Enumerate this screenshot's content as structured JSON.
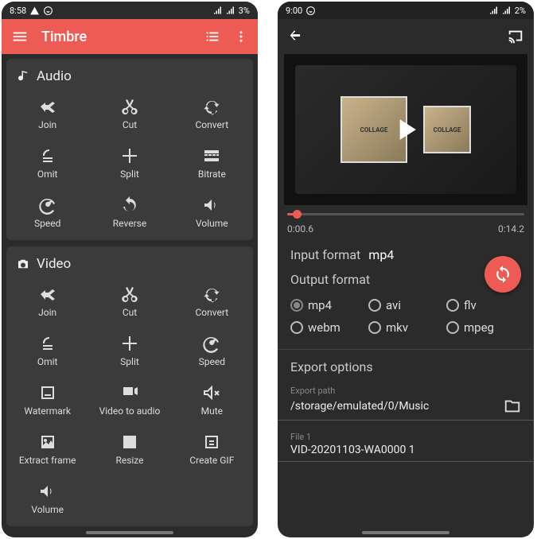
{
  "phone1": {
    "status": {
      "time": "8:58",
      "battery": "3%"
    },
    "toolbar": {
      "title": "Timbre"
    },
    "audio": {
      "title": "Audio",
      "tiles": {
        "join": "Join",
        "cut": "Cut",
        "convert": "Convert",
        "omit": "Omit",
        "split": "Split",
        "bitrate": "Bitrate",
        "speed": "Speed",
        "reverse": "Reverse",
        "volume": "Volume"
      }
    },
    "video": {
      "title": "Video",
      "tiles": {
        "join": "Join",
        "cut": "Cut",
        "convert": "Convert",
        "omit": "Omit",
        "split": "Split",
        "speed": "Speed",
        "watermark": "Watermark",
        "vid2audio": "Video to audio",
        "mute": "Mute",
        "extract": "Extract frame",
        "resize": "Resize",
        "gif": "Create GIF",
        "volume": "Volume"
      }
    }
  },
  "phone2": {
    "status": {
      "time": "9:00",
      "battery": "2%"
    },
    "album_text": "COLLAGE",
    "seek": {
      "current": "0:00.6",
      "total": "0:14.2",
      "progress_pct": 4
    },
    "input_format": {
      "label": "Input format",
      "value": "mp4"
    },
    "output_format": {
      "label": "Output format",
      "selected": "mp4",
      "options": {
        "mp4": "mp4",
        "avi": "avi",
        "flv": "flv",
        "webm": "webm",
        "mkv": "mkv",
        "mpeg": "mpeg"
      }
    },
    "export": {
      "heading": "Export options",
      "path_label": "Export path",
      "path_value": "/storage/emulated/0/Music",
      "file_label": "File 1",
      "file_value": "VID-20201103-WA0000 1"
    }
  }
}
